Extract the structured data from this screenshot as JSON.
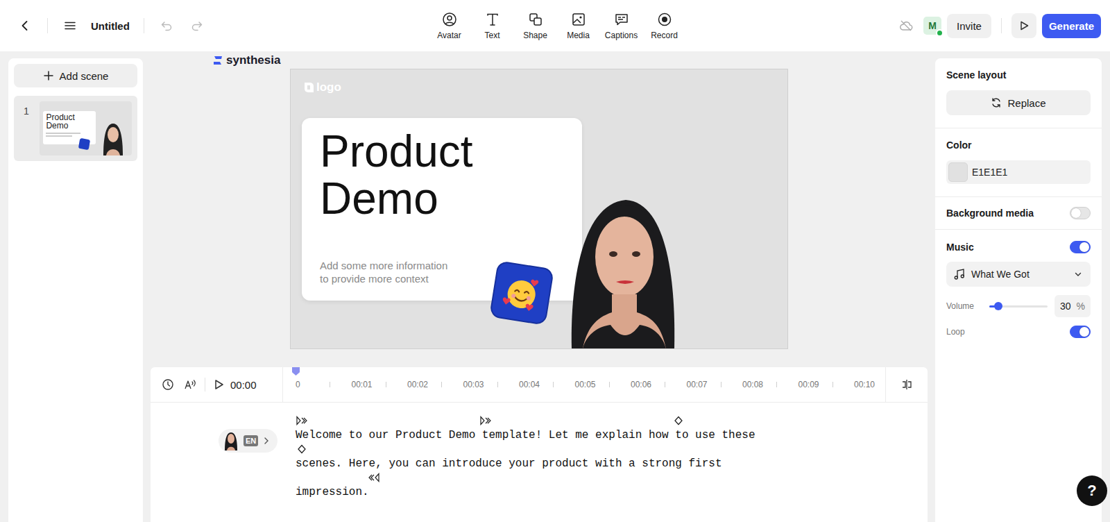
{
  "toolbar": {
    "title": "Untitled",
    "tools": [
      {
        "label": "Avatar"
      },
      {
        "label": "Text"
      },
      {
        "label": "Shape"
      },
      {
        "label": "Media"
      },
      {
        "label": "Captions"
      },
      {
        "label": "Record"
      }
    ],
    "user": {
      "initial": "M",
      "online": true
    },
    "invite": "Invite",
    "generate": "Generate"
  },
  "scenes_panel": {
    "add_scene": "Add scene",
    "scenes": [
      {
        "number": "1",
        "title": "Product Demo",
        "selected": true
      }
    ]
  },
  "brand": "synthesia",
  "canvas": {
    "logo": "logo",
    "title_lines": [
      "Product",
      "Demo"
    ],
    "subtitle_lines": [
      "Add some more information",
      "to provide more context"
    ]
  },
  "timeline": {
    "time": "00:00",
    "ticks": [
      "0",
      "00:01",
      "00:02",
      "00:03",
      "00:04",
      "00:05",
      "00:06",
      "00:07",
      "00:08",
      "00:09",
      "00:10"
    ],
    "level": 0
  },
  "script": {
    "language": "EN",
    "lines": [
      "Welcome to our Product Demo template! Let me explain how to use these",
      "scenes. Here, you can introduce your product with a strong first",
      "impression."
    ]
  },
  "properties": {
    "scene_layout": "Scene layout",
    "replace": "Replace",
    "color_label": "Color",
    "color_value": "E1E1E1",
    "background_media": {
      "label": "Background media",
      "on": false
    },
    "music": {
      "label": "Music",
      "on": true,
      "track": "What We Got"
    },
    "volume": {
      "label": "Volume",
      "level": 0.15,
      "value": "30",
      "unit": "%"
    },
    "loop": {
      "label": "Loop",
      "on": true
    }
  },
  "help": "?"
}
